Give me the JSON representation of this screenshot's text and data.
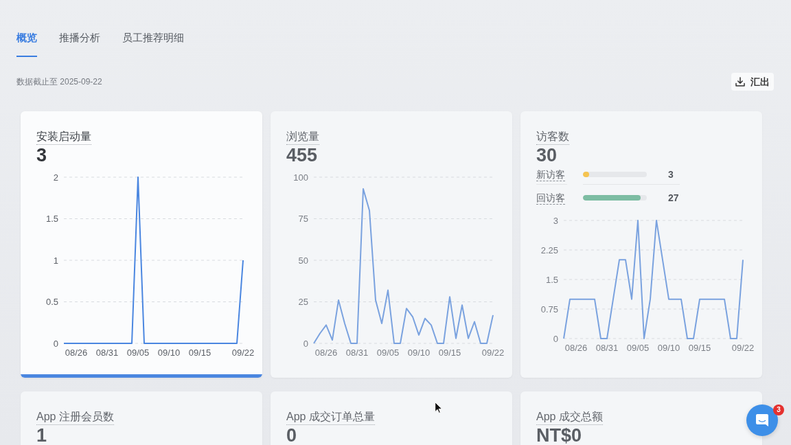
{
  "tabs": [
    {
      "label": "概览",
      "selected": true
    },
    {
      "label": "推播分析",
      "selected": false
    },
    {
      "label": "员工推荐明细",
      "selected": false
    }
  ],
  "data_note": "数据截止至 2025-09-22",
  "export_button": {
    "label": "汇出"
  },
  "metric_cards": [
    {
      "title": "安装启动量",
      "value": "3",
      "selected": true,
      "chart_data": {
        "type": "line",
        "grid": true,
        "categories": [
          null,
          null,
          "08/26",
          null,
          null,
          null,
          null,
          "08/31",
          null,
          null,
          null,
          null,
          "09/05",
          null,
          null,
          null,
          null,
          "09/10",
          null,
          null,
          null,
          null,
          "09/15",
          null,
          null,
          null,
          null,
          null,
          null,
          "09/22"
        ],
        "ylim": [
          0,
          2
        ],
        "yticks": [
          0,
          0.5,
          1,
          1.5,
          2
        ],
        "series": [
          {
            "color": "#4a86e0",
            "values": [
              0,
              0,
              0,
              0,
              0,
              0,
              0,
              0,
              0,
              0,
              0,
              0,
              2,
              0,
              0,
              0,
              0,
              0,
              0,
              0,
              0,
              0,
              0,
              0,
              0,
              0,
              0,
              0,
              0,
              1
            ]
          }
        ]
      }
    },
    {
      "title": "浏览量",
      "value": "455",
      "selected": false,
      "chart_data": {
        "type": "line",
        "grid": true,
        "categories": [
          null,
          null,
          "08/26",
          null,
          null,
          null,
          null,
          "08/31",
          null,
          null,
          null,
          null,
          "09/05",
          null,
          null,
          null,
          null,
          "09/10",
          null,
          null,
          null,
          null,
          "09/15",
          null,
          null,
          null,
          null,
          null,
          null,
          "09/22"
        ],
        "ylim": [
          0,
          100
        ],
        "yticks": [
          0,
          25,
          50,
          75,
          100
        ],
        "series": [
          {
            "color": "#7aa2df",
            "values": [
              0,
              6,
              11,
              2,
              26,
              12,
              0,
              0,
              93,
              80,
              26,
              12,
              32,
              0,
              0,
              21,
              16,
              5,
              15,
              11,
              0,
              0,
              28,
              3,
              23,
              3,
              13,
              0,
              0,
              17
            ]
          }
        ]
      }
    },
    {
      "title": "访客数",
      "value": "30",
      "selected": false,
      "breakdown": [
        {
          "label": "新访客",
          "count": "3",
          "level": 0.1,
          "color": "#f5c451"
        },
        {
          "label": "回访客",
          "count": "27",
          "level": 0.9,
          "color": "#7dbda3"
        }
      ],
      "chart_data": {
        "type": "line",
        "grid": true,
        "categories": [
          null,
          null,
          "08/26",
          null,
          null,
          null,
          null,
          "08/31",
          null,
          null,
          null,
          null,
          "09/05",
          null,
          null,
          null,
          null,
          "09/10",
          null,
          null,
          null,
          null,
          "09/15",
          null,
          null,
          null,
          null,
          null,
          null,
          "09/22"
        ],
        "ylim": [
          0,
          3
        ],
        "yticks": [
          0,
          0.75,
          1.5,
          2.25,
          3
        ],
        "series": [
          {
            "color": "#7aa2df",
            "values": [
              0,
              1,
              1,
              1,
              1,
              1,
              0,
              0,
              1,
              2,
              2,
              1,
              3,
              0,
              1,
              3,
              2,
              1,
              1,
              1,
              0,
              0,
              1,
              1,
              1,
              1,
              1,
              0,
              0,
              2
            ]
          }
        ]
      }
    },
    {
      "title": "App 注册会员数",
      "value": "1",
      "selected": false
    },
    {
      "title": "App 成交订单总量",
      "value": "0",
      "selected": false
    },
    {
      "title": "App 成交总额",
      "value": "NT$0",
      "selected": false
    }
  ],
  "chat_launcher": {
    "badge": "3"
  }
}
